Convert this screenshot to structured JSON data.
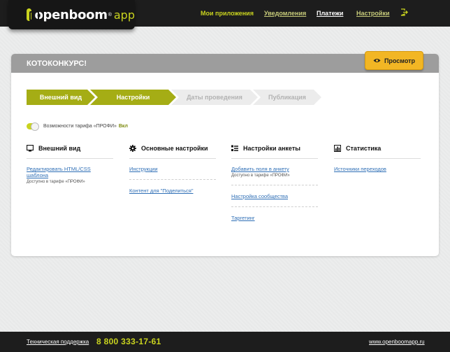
{
  "header": {
    "logo_text": "openboom",
    "logo_reg": "®",
    "logo_app": "app",
    "nav": [
      {
        "label": "Мои приложения"
      },
      {
        "label": "Уведомления"
      },
      {
        "label": "Платежи"
      },
      {
        "label": "Настройки"
      }
    ]
  },
  "panel": {
    "title": "КОТОКОНКУРС!",
    "preview_label": "Просмотр"
  },
  "steps": [
    {
      "label": "Внешний вид",
      "active": true
    },
    {
      "label": "Настройки",
      "active": true
    },
    {
      "label": "Даты проведения",
      "active": false
    },
    {
      "label": "Публикация",
      "active": false
    }
  ],
  "toggle": {
    "label": "Возможности тарифа «ПРОФИ»",
    "state": "Вкл"
  },
  "columns": [
    {
      "title": "Внешний вид",
      "icon": "monitor-icon",
      "items": [
        {
          "label": "Редактировать HTML/CSS шаблона",
          "note": "Доступно в тарифе «ПРОФИ»"
        }
      ]
    },
    {
      "title": "Основные настройки",
      "icon": "gear-icon",
      "items": [
        {
          "label": "Инструкции",
          "note": ""
        },
        {
          "label": "Контент для \"Поделиться\"",
          "note": ""
        }
      ]
    },
    {
      "title": "Настройки анкеты",
      "icon": "form-list-icon",
      "items": [
        {
          "label": "Добавить поля в анкету",
          "note": "Доступно в тарифе «ПРОФИ»"
        },
        {
          "label": "Настройка сообщества",
          "note": ""
        },
        {
          "label": "Таргетинг",
          "note": ""
        }
      ]
    },
    {
      "title": "Статистика",
      "icon": "bar-chart-icon",
      "items": [
        {
          "label": "Источники переходов",
          "note": ""
        }
      ]
    }
  ],
  "footer": {
    "support": "Техническая поддержка",
    "phone": "8 800 333-17-61",
    "site": "www.openboomapp.ru"
  },
  "colors": {
    "accent": "#c9d31f",
    "step_active": "#a5ad15",
    "preview_button": "#f2b624",
    "link": "#2f6fb6"
  }
}
